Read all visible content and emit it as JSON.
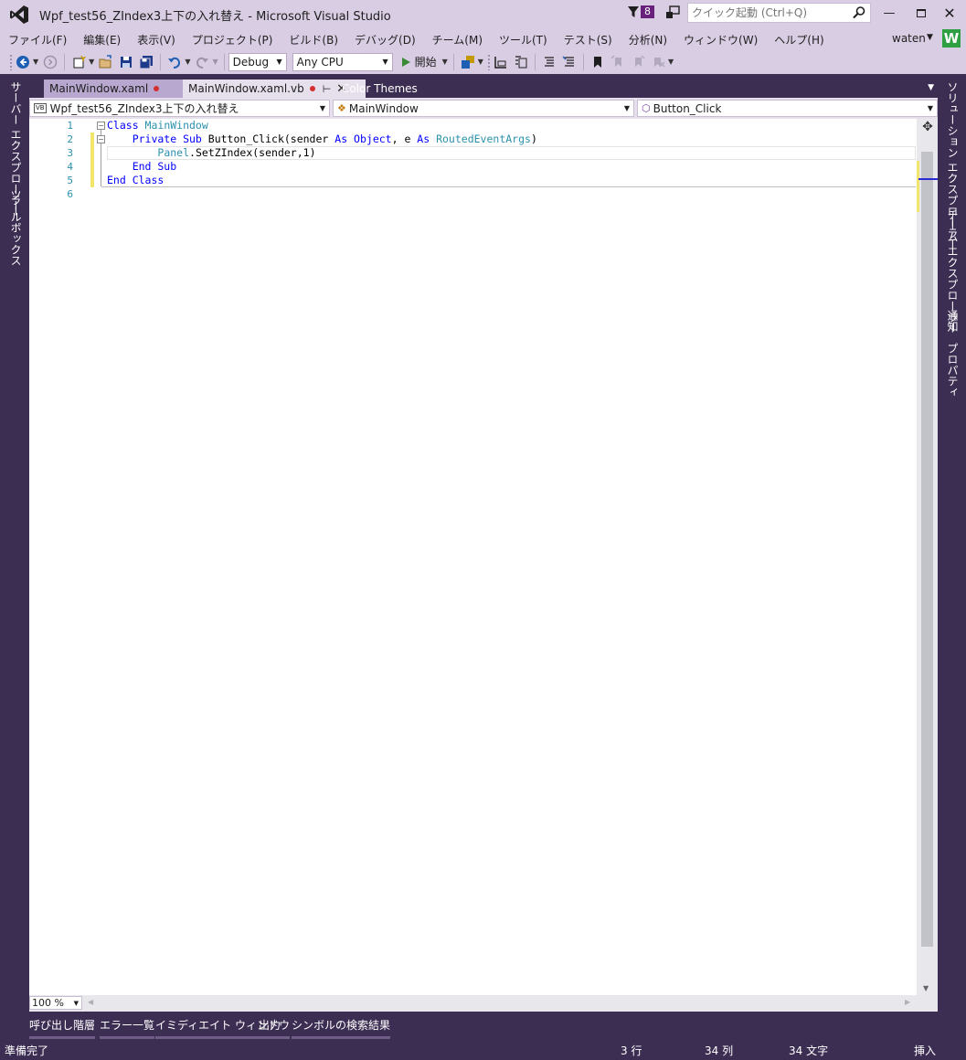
{
  "window": {
    "title": "Wpf_test56_ZIndex3上下の入れ替え - Microsoft Visual Studio",
    "notification_count": "8",
    "quick_launch_placeholder": "クイック起動 (Ctrl+Q)",
    "user_name": "waten",
    "avatar_letter": "W",
    "accent_color": "#68217a"
  },
  "menu": [
    "ファイル(F)",
    "編集(E)",
    "表示(V)",
    "プロジェクト(P)",
    "ビルド(B)",
    "デバッグ(D)",
    "チーム(M)",
    "ツール(T)",
    "テスト(S)",
    "分析(N)",
    "ウィンドウ(W)",
    "ヘルプ(H)"
  ],
  "toolbar": {
    "configuration": "Debug",
    "platform": "Any CPU",
    "start_label": "開始"
  },
  "left_dock": [
    "サーバー エクスプローラー",
    "ツールボックス"
  ],
  "right_dock": [
    "ソリューション エクスプローラー",
    "チーム エクスプローラー",
    "通知",
    "プロパティ"
  ],
  "tabs": [
    {
      "label": "MainWindow.xaml",
      "modified": true
    },
    {
      "label": "MainWindow.xaml.vb",
      "modified": true
    },
    {
      "label": "Color Themes"
    }
  ],
  "navbar": {
    "project": "Wpf_test56_ZIndex3上下の入れ替え",
    "project_badge": "VB",
    "class": "MainWindow",
    "member": "Button_Click"
  },
  "code": {
    "line_numbers": [
      "1",
      "2",
      "3",
      "4",
      "5",
      "6"
    ],
    "lines": [
      [
        {
          "t": "Class ",
          "c": "kw"
        },
        {
          "t": "MainWindow",
          "c": "ty"
        }
      ],
      [
        {
          "t": "    Private Sub ",
          "c": "kw"
        },
        {
          "t": "Button_Click(sender ",
          "c": ""
        },
        {
          "t": "As ",
          "c": "kw"
        },
        {
          "t": "Object",
          "c": "kw"
        },
        {
          "t": ", e ",
          "c": ""
        },
        {
          "t": "As ",
          "c": "kw"
        },
        {
          "t": "RoutedEventArgs",
          "c": "ty"
        },
        {
          "t": ")",
          "c": ""
        }
      ],
      [
        {
          "t": "        ",
          "c": ""
        },
        {
          "t": "Panel",
          "c": "ty"
        },
        {
          "t": ".SetZIndex(sender,1)",
          "c": ""
        }
      ],
      [
        {
          "t": "    End Sub",
          "c": "kw"
        }
      ],
      [
        {
          "t": "End Class",
          "c": "kw"
        }
      ],
      []
    ]
  },
  "zoom": "100 %",
  "bottom_tabs": [
    "呼び出し階層",
    "エラー一覧",
    "イミディエイト ウィンドウ",
    "出力",
    "シンボルの検索結果"
  ],
  "status": {
    "message": "準備完了",
    "line": "3 行",
    "column": "34 列",
    "char": "34 文字",
    "mode": "挿入"
  }
}
